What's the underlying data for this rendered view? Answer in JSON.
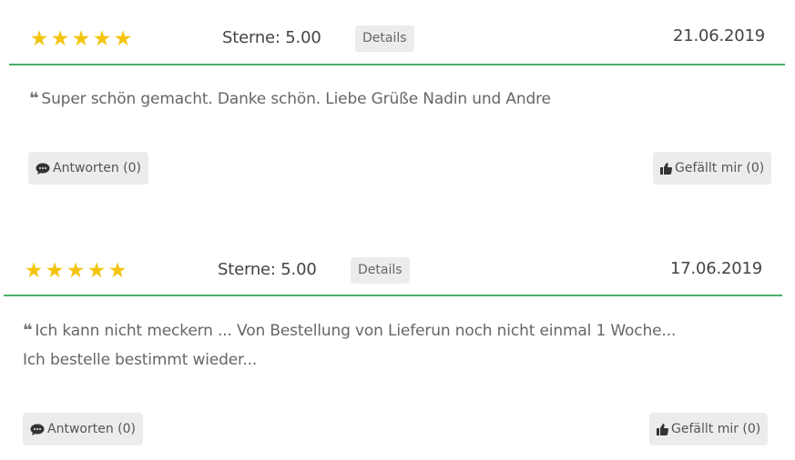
{
  "reviews": [
    {
      "stars_count": 5,
      "sterne_text": "Sterne: 5.00",
      "details_label": "Details",
      "date": "21.06.2019",
      "quote_lines": [
        "Super schön gemacht. Danke schön. Liebe Grüße Nadin und Andre"
      ],
      "reply_label": "Antworten (0)",
      "like_label": "Gefällt mir (0)"
    },
    {
      "stars_count": 5,
      "sterne_text": "Sterne: 5.00",
      "details_label": "Details",
      "date": "17.06.2019",
      "quote_lines": [
        "Ich kann nicht meckern ... Von Bestellung von Lieferun noch nicht einmal 1 Woche...",
        "Ich bestelle bestimmt wieder..."
      ],
      "reply_label": "Antworten (0)",
      "like_label": "Gefällt mir (0)"
    }
  ],
  "colors": {
    "star": "#f3c40f",
    "divider": "#4caf65",
    "button_bg": "#ececec"
  },
  "icons": {
    "star": "star-icon",
    "quote": "quote-icon",
    "reply": "speech-bubble-icon",
    "like": "thumbs-up-icon"
  }
}
